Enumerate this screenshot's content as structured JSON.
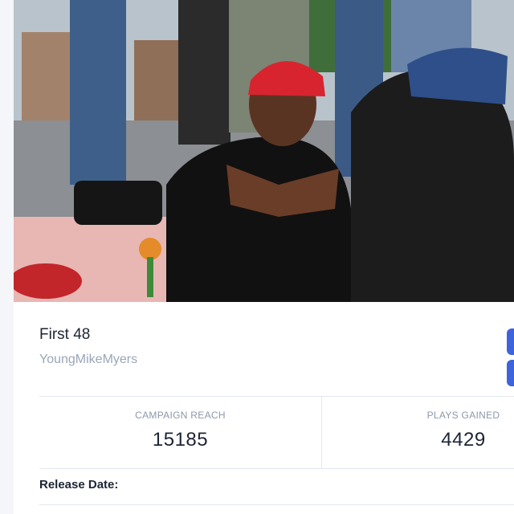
{
  "track": {
    "title": "First 48",
    "artist": "YoungMikeMyers"
  },
  "stats": [
    {
      "label": "CAMPAIGN REACH",
      "value": "15185"
    },
    {
      "label": "PLAYS GAINED",
      "value": "4429"
    }
  ],
  "release": {
    "label": "Release Date:"
  },
  "colors": {
    "accent": "#3d63dd",
    "title_text": "#1d2433",
    "muted_text": "#9aa6b8",
    "divider": "#e3e8ef"
  }
}
